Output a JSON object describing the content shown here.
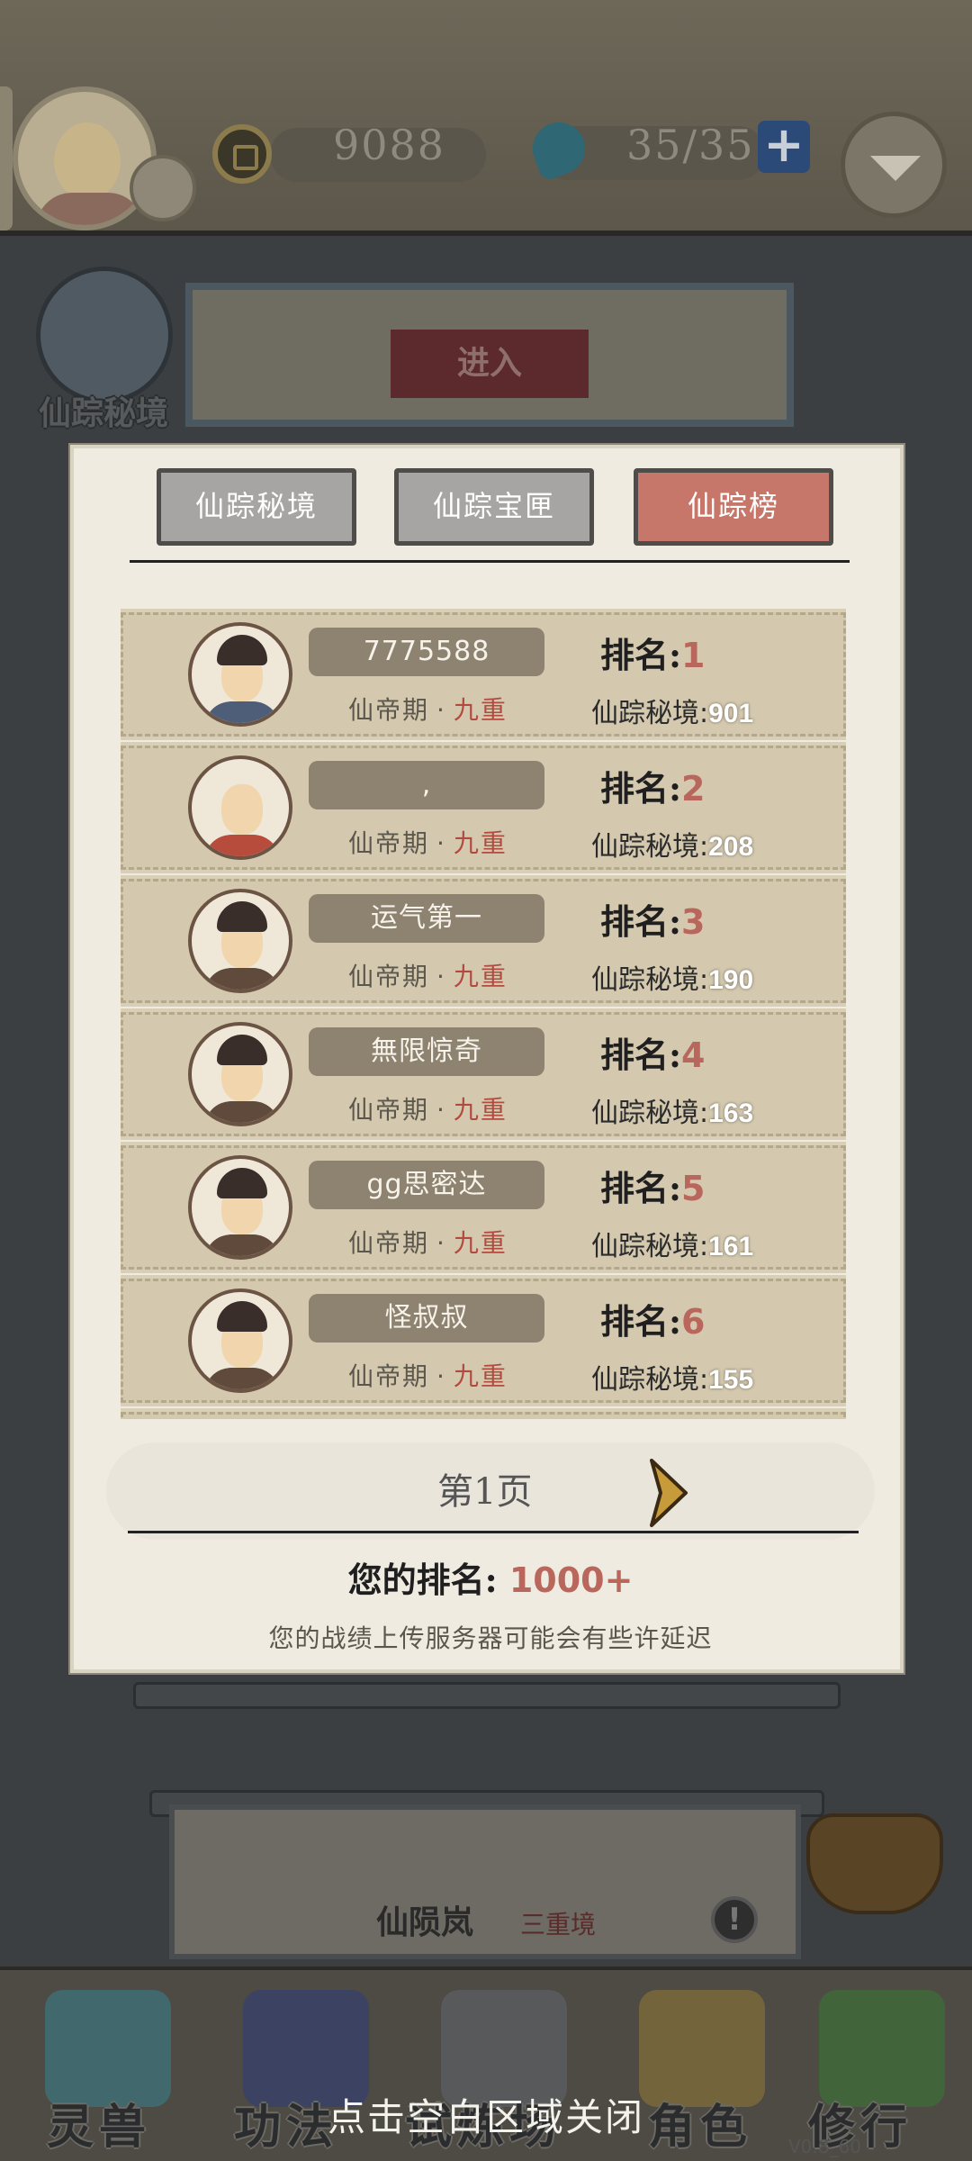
{
  "topbar": {
    "coins": "9088",
    "stamina": "35/35",
    "plus_label": "+"
  },
  "background": {
    "secret_realm_label": "仙踪秘境",
    "enter_button": "进入",
    "panel2_title": "仙陨岚",
    "panel2_tier": "三重境",
    "info_glyph": "!"
  },
  "modal": {
    "tabs": [
      {
        "label": "仙踪秘境",
        "active": false
      },
      {
        "label": "仙踪宝匣",
        "active": false
      },
      {
        "label": "仙踪榜",
        "active": true
      }
    ],
    "rank_prefix": "排名:",
    "score_prefix": "仙踪秘境:",
    "rows": [
      {
        "name": "7775588",
        "realm": "仙帝期",
        "tier": "九重",
        "rank": "1",
        "score": "901",
        "avatar": "scholar-avatar"
      },
      {
        "name": ",",
        "realm": "仙帝期",
        "tier": "九重",
        "rank": "2",
        "score": "208",
        "avatar": "monk-avatar"
      },
      {
        "name": "运气第一",
        "realm": "仙帝期",
        "tier": "九重",
        "rank": "3",
        "score": "190",
        "avatar": "warrior-avatar"
      },
      {
        "name": "無限惊奇",
        "realm": "仙帝期",
        "tier": "九重",
        "rank": "4",
        "score": "163",
        "avatar": "warrior-avatar"
      },
      {
        "name": "gg思密达",
        "realm": "仙帝期",
        "tier": "九重",
        "rank": "5",
        "score": "161",
        "avatar": "warrior-avatar"
      },
      {
        "name": "怪叔叔",
        "realm": "仙帝期",
        "tier": "九重",
        "rank": "6",
        "score": "155",
        "avatar": "warrior-avatar"
      }
    ],
    "realm_dot": "·",
    "page_label": "第1页",
    "your_rank_prefix": "您的排名:",
    "your_rank_value": "1000+",
    "disclaimer": "您的战绩上传服务器可能会有些许延迟"
  },
  "bottom_nav": [
    {
      "label": "灵兽",
      "icon": "feather-icon"
    },
    {
      "label": "功法",
      "icon": "book-icon"
    },
    {
      "label": "试炼场",
      "icon": "mountain-icon"
    },
    {
      "label": "角色",
      "icon": "hat-icon"
    },
    {
      "label": "修行",
      "icon": "gourd-icon"
    }
  ],
  "close_hint": "点击空白区域关闭",
  "version": "V0.8_60",
  "colors": {
    "active_tab": "#c7776a",
    "inactive_tab": "#a6a5a3",
    "rank_number": "#b9665c",
    "tier_text": "#b24a40"
  }
}
